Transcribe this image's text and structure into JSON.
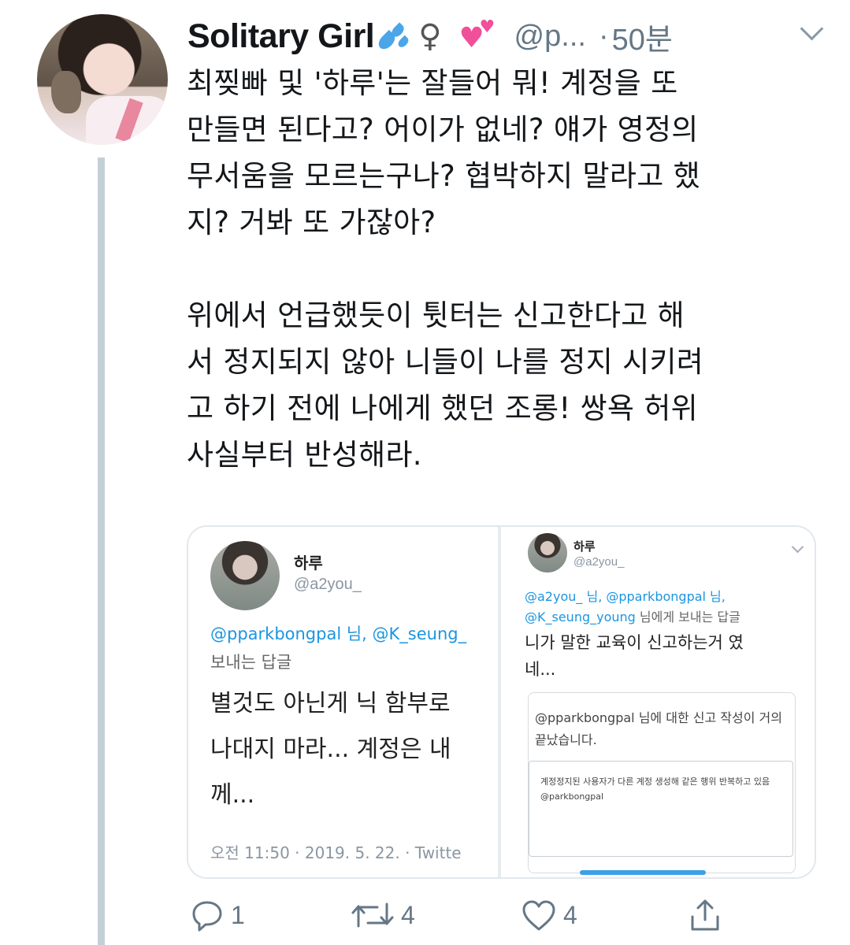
{
  "tweet": {
    "name": "Solitary Girl",
    "female_symbol": "♀",
    "handle": "@p...",
    "separator": "·",
    "time": "50분",
    "text": "최찢빠 및 '하루'는 잘들어 뭐! 계정을 또\n만들면 된다고? 어이가 없네? 얘가 영정의\n무서움을 모르는구나? 협박하지 말라고 했\n지? 거봐 또 가잖아?\n\n위에서 언급했듯이 튓터는 신고한다고 해\n서 정지되지 않아 니들이 나를 정지 시키려\n고 하기 전에 나에게 했던 조롱! 쌍욕 허위\n사실부터 반성해라.",
    "icons": {
      "avatar": "profile-photo",
      "emoji1": "sweat-droplets",
      "emoji2": "two-hearts",
      "menu": "chevron-down-icon"
    },
    "colors": {
      "muted": "#657786",
      "thread": "#c4cfd6",
      "link": "#1b95e0"
    }
  },
  "media": {
    "left": {
      "name": "하루",
      "handle": "@a2you_",
      "reply_mention": "@pparkbongpal 님, @K_seung_",
      "reply_suffix": "보내는 답글",
      "body": "별것도 아닌게 닉 함부로\n나대지 마라... 계정은 내\n께...",
      "date": "오전 11:50 · 2019. 5. 22. · Twitte"
    },
    "right": {
      "name": "하루",
      "handle": "@a2you_",
      "reply_line1": "@a2you_ 님, @pparkbongpal 님,",
      "reply_line2_mention": "@K_seung_young",
      "reply_line2_suffix": " 님에게 보내는 답글",
      "body": "니가 말한 교육이 신고하는거 였\n네...",
      "report_title": "@pparkbongpal 님에 대한 신고 작성이 거의 끝났습니다.",
      "report_text": "계정정지된 사용자가 다른 계정 생성해 같은 행위 반복하고 있음 @parkbongpal"
    }
  },
  "actions": {
    "reply_count": "1",
    "retweet_count": "4",
    "like_count": "4"
  }
}
